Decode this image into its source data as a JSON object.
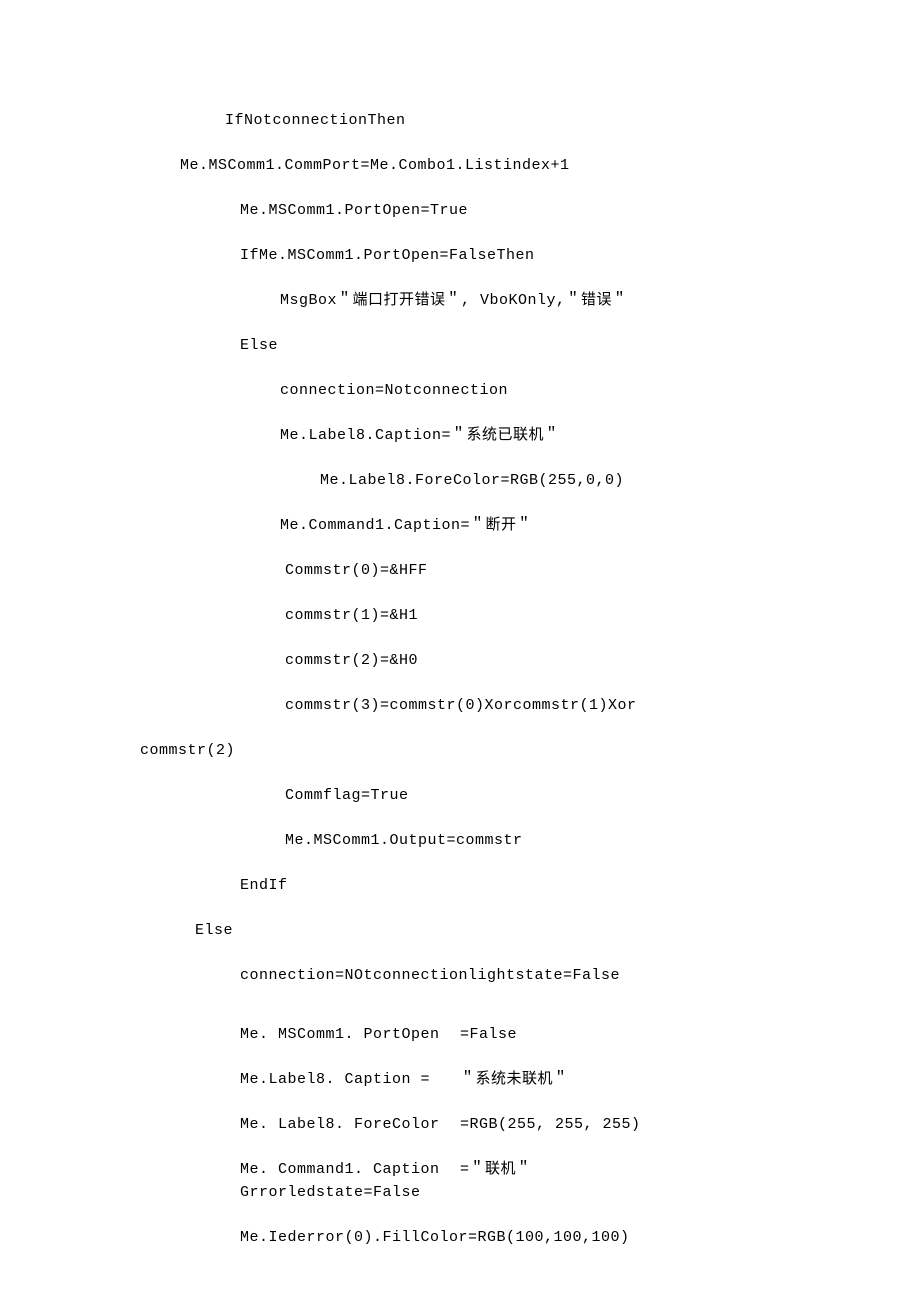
{
  "lines": {
    "l1": "IfNotconnectionThen",
    "l2": "Me.MSComm1.CommPort=Me.Combo1.Listindex+1",
    "l3": "Me.MSComm1.PortOpen=True",
    "l4": "IfMe.MSComm1.PortOpen=FalseThen",
    "l5": "MsgBox＂端口打开错误＂, VboKOnly,＂错误＂",
    "l6": "Else",
    "l7": "connection=Notconnection",
    "l8": "Me.Label8.Caption=＂系统已联机＂",
    "l9": "Me.Label8.ForeColor=RGB(255,0,0)",
    "l10": "Me.Command1.Caption=＂断开＂",
    "l11": "Commstr(0)=&HFF",
    "l12": "commstr(1)=&H1",
    "l13": "commstr(2)=&H0",
    "l14": "commstr(3)=commstr(0)Xorcommstr(1)Xor",
    "l15": "commstr(2)",
    "l16": "Commflag=True",
    "l17": "Me.MSComm1.Output=commstr",
    "l18": "EndIf",
    "l19": "Else",
    "l20": "connection=NOtconnectionlightstate=False",
    "l21a": "Me. MSComm1. PortOpen",
    "l21b": "=False",
    "l22a": "Me.Label8. Caption =",
    "l22b": "＂系统未联机＂",
    "l23a": "Me. Label8. ForeColor",
    "l23b": "=RGB(255, 255, 255)",
    "l24a": "Me. Command1. Caption",
    "l24b": "=＂联机＂",
    "l25": "Grrorledstate=False",
    "l26": "Me.Iederror(0).FillColor=RGB(100,100,100)"
  }
}
